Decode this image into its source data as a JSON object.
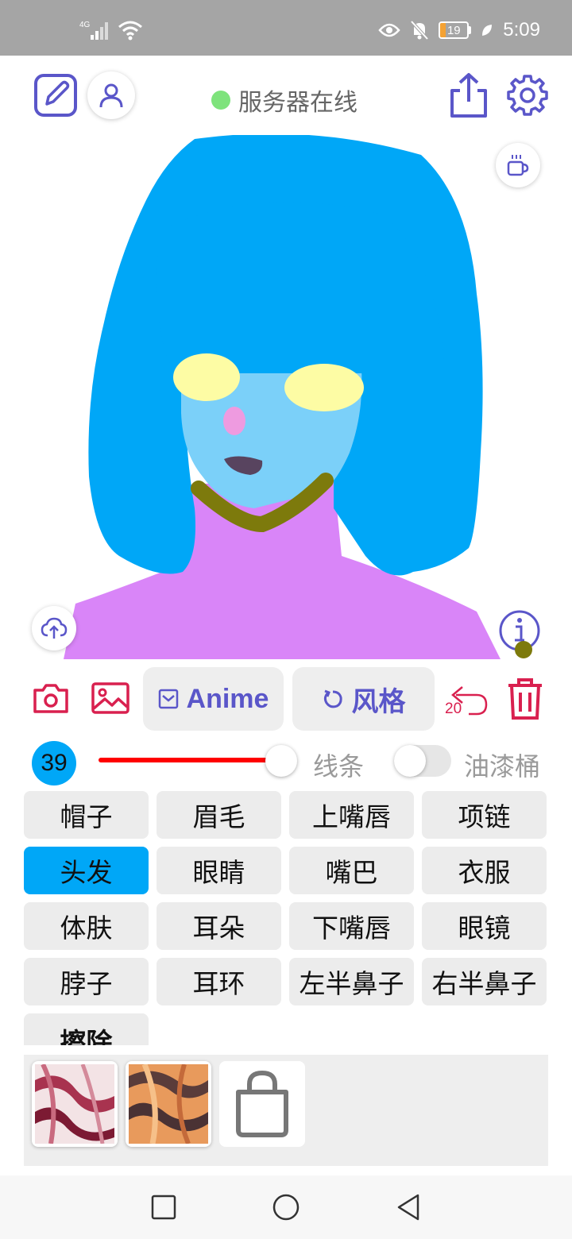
{
  "status_bar": {
    "network": "4G",
    "battery": "19",
    "time": "5:09"
  },
  "header": {
    "server_status": "服务器在线",
    "server_status_color": "#7ee37c"
  },
  "toolbar": {
    "model_label": "Anime",
    "style_label": "风格",
    "undo_count": "20",
    "accent_color": "#5a56c9",
    "danger_color": "#d9204f"
  },
  "brush": {
    "size": "39",
    "line_label": "线条",
    "bucket_label": "油漆桶",
    "bucket_enabled": false,
    "slider_fraction": 0.95
  },
  "parts": [
    {
      "label": "帽子",
      "active": false
    },
    {
      "label": "眉毛",
      "active": false
    },
    {
      "label": "上嘴唇",
      "active": false
    },
    {
      "label": "项链",
      "active": false
    },
    {
      "label": "头发",
      "active": true
    },
    {
      "label": "眼睛",
      "active": false
    },
    {
      "label": "嘴巴",
      "active": false
    },
    {
      "label": "衣服",
      "active": false
    },
    {
      "label": "体肤",
      "active": false
    },
    {
      "label": "耳朵",
      "active": false
    },
    {
      "label": "下嘴唇",
      "active": false
    },
    {
      "label": "眼镜",
      "active": false
    },
    {
      "label": "脖子",
      "active": false
    },
    {
      "label": "耳环",
      "active": false
    },
    {
      "label": "左半鼻子",
      "active": false
    },
    {
      "label": "右半鼻子",
      "active": false
    },
    {
      "label": "擦除",
      "active": false
    }
  ],
  "palette": {
    "hair": "#00a7f7",
    "skin": "#7bd0f9",
    "glasses": "#fdfca4",
    "cheek": "#ee9be0",
    "mouth": "#58445f",
    "necklace": "#7d7a0c",
    "clothes": "#d985f8",
    "selected_part": "#00a7f7"
  },
  "icons": {
    "edit": "edit-icon",
    "user": "user-icon",
    "share": "share-icon",
    "settings": "gear-icon",
    "coffee": "coffee-icon",
    "upload": "cloud-upload-icon",
    "info": "info-icon",
    "camera": "camera-icon",
    "image": "image-icon",
    "undo": "undo-icon",
    "trash": "trash-icon",
    "store": "shopping-bag-icon"
  }
}
